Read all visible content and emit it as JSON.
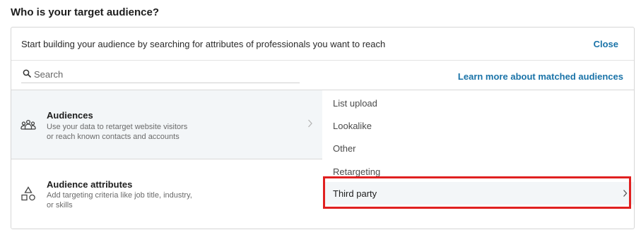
{
  "header": {
    "title": "Who is your target audience?"
  },
  "intro": {
    "text": "Start building your audience by searching for attributes of professionals you want to reach",
    "close_label": "Close"
  },
  "search": {
    "placeholder": "Search",
    "learn_more_label": "Learn more about matched audiences"
  },
  "categories": [
    {
      "title": "Audiences",
      "description_line1": "Use your data to retarget website visitors",
      "description_line2": "or reach known contacts and accounts",
      "icon": "people-group-icon",
      "selected": true
    },
    {
      "title": "Audience attributes",
      "description_line1": "Add targeting criteria like job title, industry,",
      "description_line2": "or skills",
      "icon": "shapes-icon",
      "selected": false
    }
  ],
  "options": [
    {
      "label": "List upload"
    },
    {
      "label": "Lookalike"
    },
    {
      "label": "Other"
    },
    {
      "label": "Retargeting"
    },
    {
      "label": "Third party",
      "highlighted": true
    }
  ],
  "colors": {
    "link": "#1a73a8",
    "selected_bg": "#f3f6f8",
    "highlight_border": "#e02020"
  }
}
